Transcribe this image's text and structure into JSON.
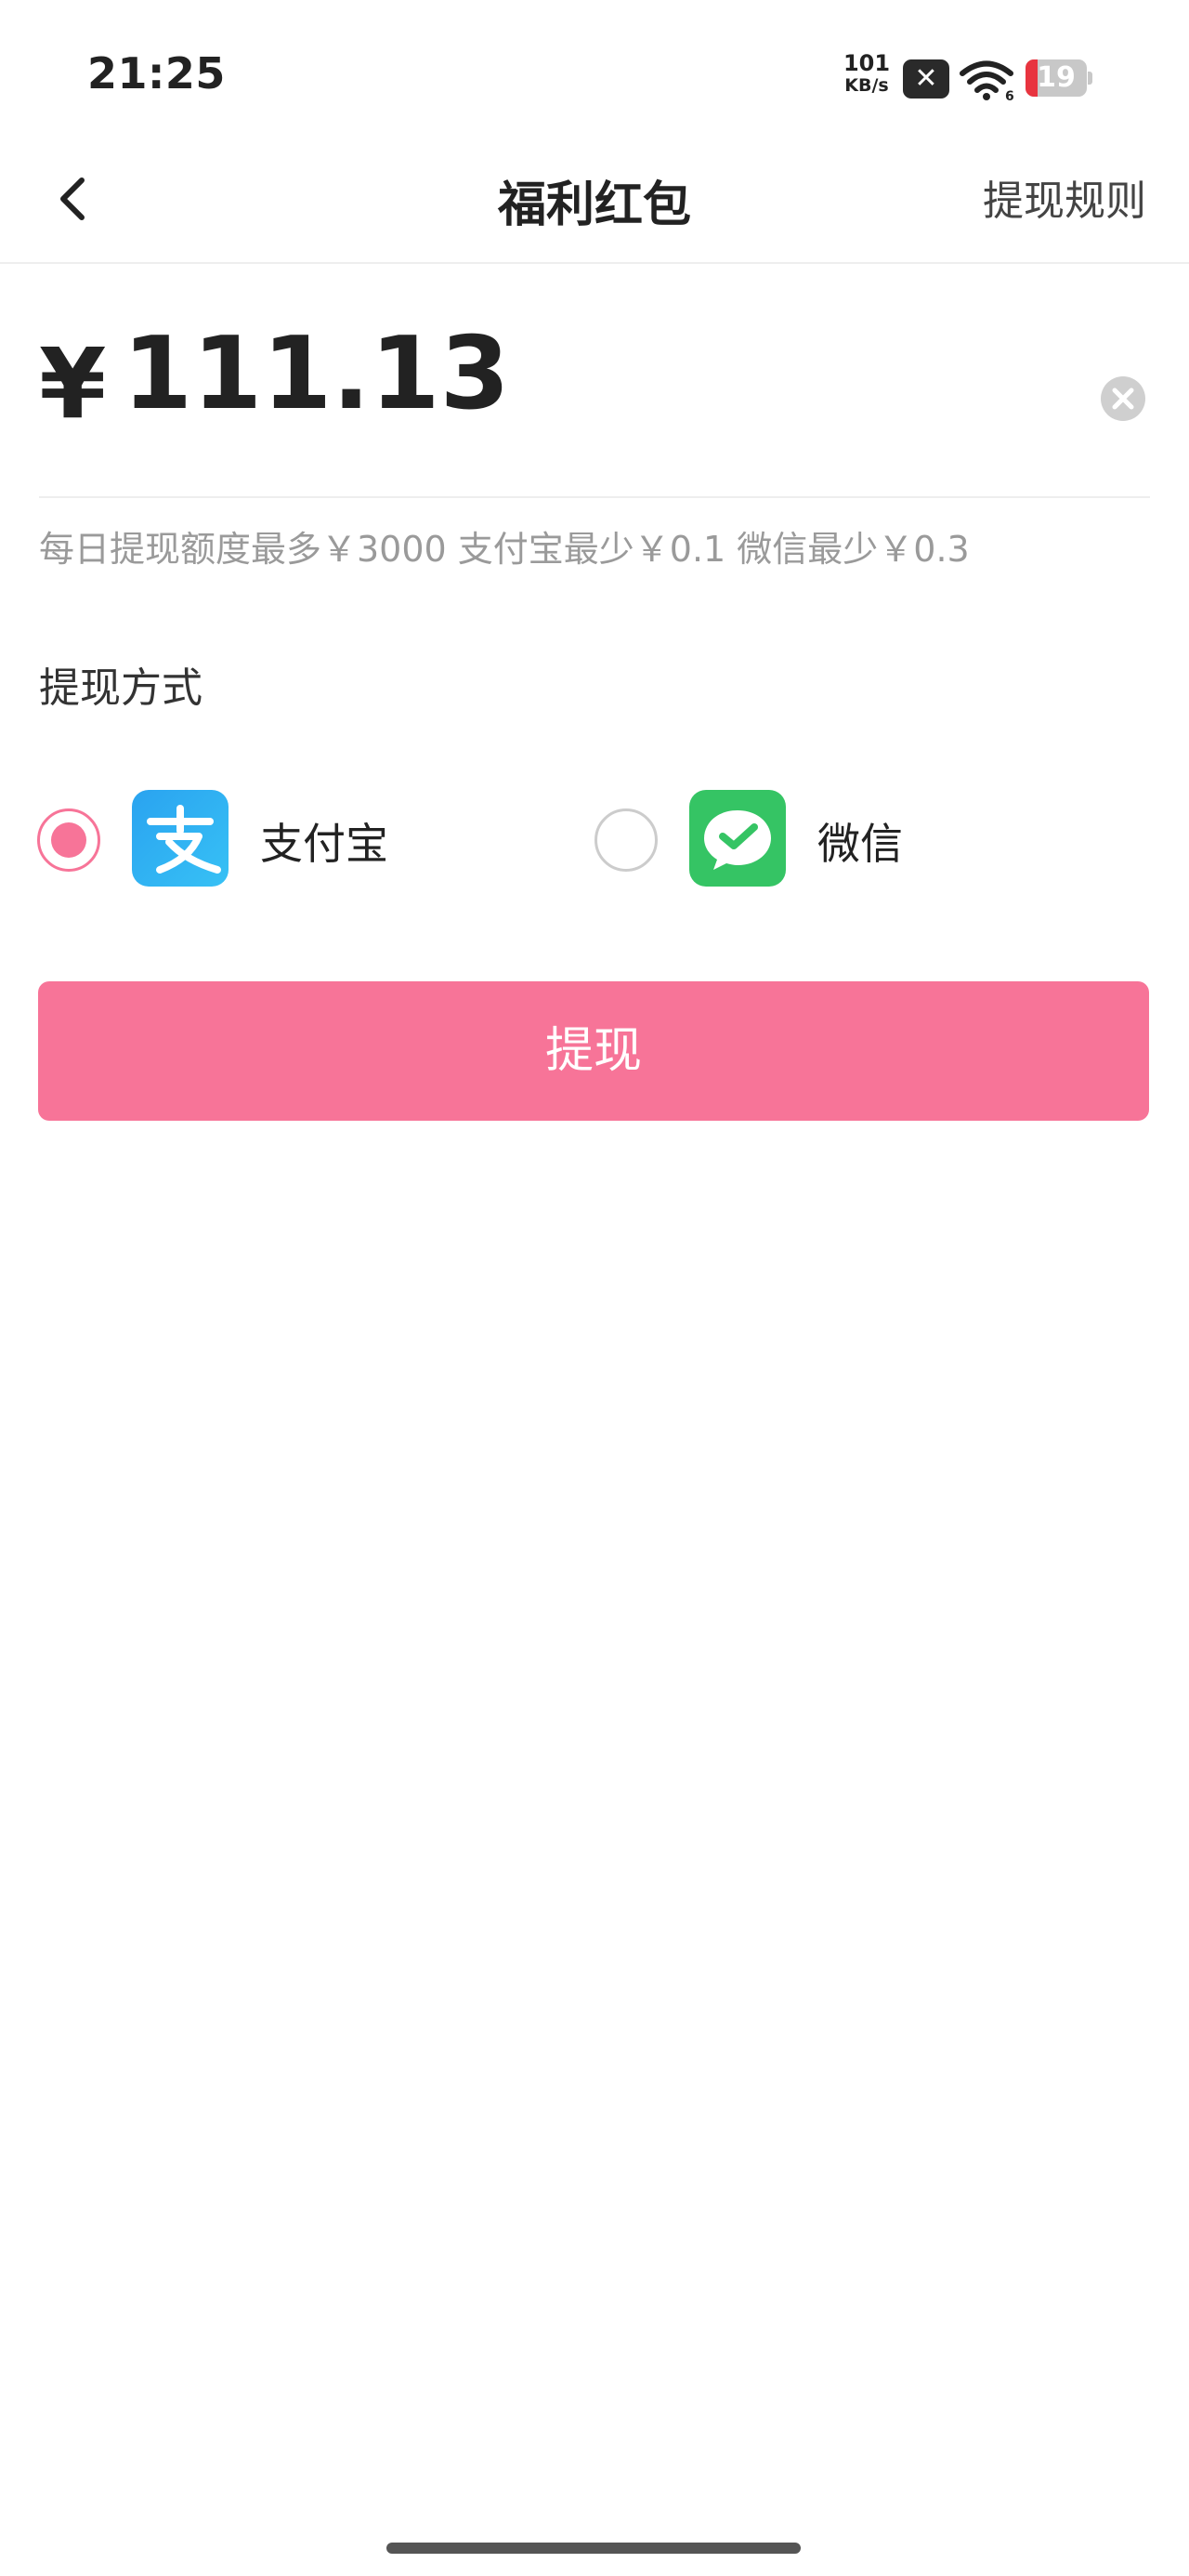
{
  "status_bar": {
    "time": "21:25",
    "net_speed_value": "101",
    "net_speed_unit": "KB/s",
    "sim_icon": "sim-off-icon",
    "wifi_icon": "wifi-icon",
    "battery_level": "19",
    "battery_fill": 0.19,
    "battery_color": "#e8343f"
  },
  "nav": {
    "back_icon": "chevron-left-icon",
    "title": "福利红包",
    "rules_link": "提现规则"
  },
  "amount": {
    "currency": "¥",
    "value": "111.13",
    "clear_icon": "clear-circle-icon"
  },
  "limit_hint": "每日提现额度最多￥3000 支付宝最少￥0.1 微信最少￥0.3",
  "method_label": "提现方式",
  "payment_methods": [
    {
      "label": "支付宝",
      "icon": "alipay-icon",
      "selected": true,
      "color": "#2aa8f0"
    },
    {
      "label": "微信",
      "icon": "wechat-icon",
      "selected": false,
      "color": "#35c464"
    }
  ],
  "withdraw_button": "提现",
  "colors": {
    "accent": "#f77498",
    "hint_text": "#9a9a9a"
  }
}
